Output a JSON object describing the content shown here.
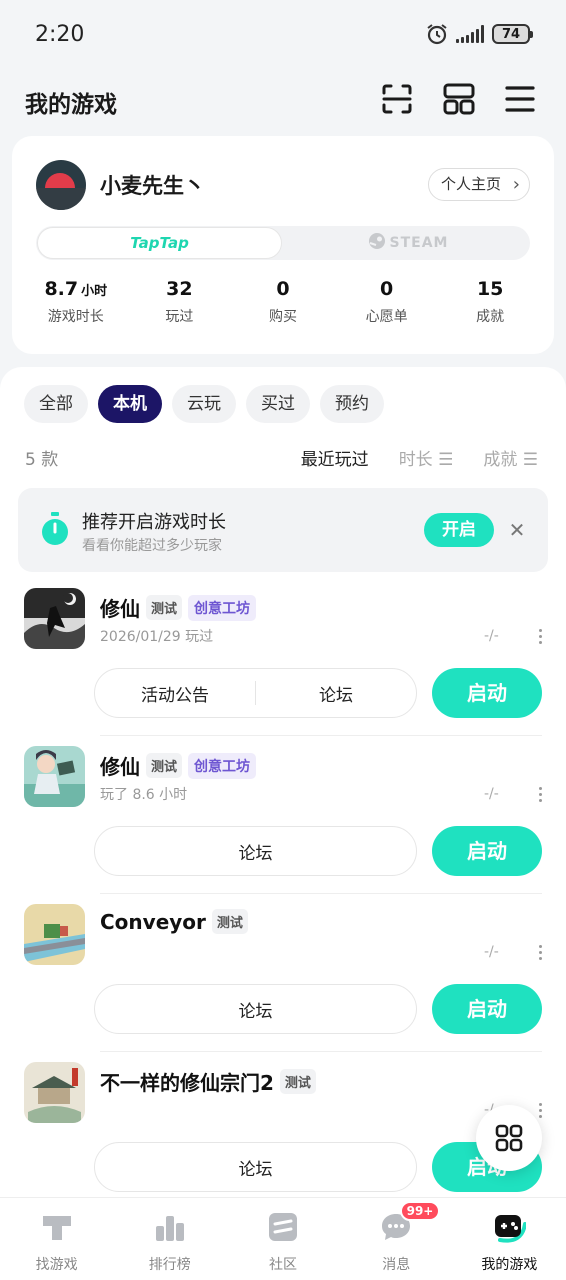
{
  "status": {
    "time": "2:20",
    "battery": "74"
  },
  "header": {
    "title": "我的游戏"
  },
  "profile": {
    "username": "小麦先生丶",
    "home_button": "个人主页",
    "platforms": {
      "taptap": "TapTap",
      "steam": "STEAM"
    },
    "stats": [
      {
        "value": "8.7",
        "unit": "小时",
        "label": "游戏时长"
      },
      {
        "value": "32",
        "unit": "",
        "label": "玩过"
      },
      {
        "value": "0",
        "unit": "",
        "label": "购买"
      },
      {
        "value": "0",
        "unit": "",
        "label": "心愿单"
      },
      {
        "value": "15",
        "unit": "",
        "label": "成就"
      }
    ]
  },
  "filters": [
    "全部",
    "本机",
    "云玩",
    "买过",
    "预约"
  ],
  "count": "5 款",
  "sorts": [
    "最近玩过",
    "时长",
    "成就"
  ],
  "promo": {
    "title": "推荐开启游戏时长",
    "subtitle": "看看你能超过多少玩家",
    "button": "开启"
  },
  "games": [
    {
      "name": "修仙",
      "tags": [
        "测试",
        "创意工坊"
      ],
      "sub": "2026/01/29 玩过",
      "dash": "-/-",
      "links": [
        "活动公告",
        "论坛"
      ],
      "start": "启动"
    },
    {
      "name": "修仙",
      "tags": [
        "测试",
        "创意工坊"
      ],
      "sub": "玩了 8.6 小时",
      "dash": "-/-",
      "links": [
        "论坛"
      ],
      "start": "启动"
    },
    {
      "name": "Conveyor",
      "tags": [
        "测试"
      ],
      "sub": "",
      "dash": "-/-",
      "links": [
        "论坛"
      ],
      "start": "启动"
    },
    {
      "name": "不一样的修仙宗门2",
      "tags": [
        "测试"
      ],
      "sub": "",
      "dash": "-/-",
      "links": [
        "论坛"
      ],
      "start": "启动"
    }
  ],
  "tabbar": [
    {
      "label": "找游戏",
      "icon": "taptap-logo-icon"
    },
    {
      "label": "排行榜",
      "icon": "ranking-icon"
    },
    {
      "label": "社区",
      "icon": "community-icon"
    },
    {
      "label": "消息",
      "icon": "message-icon",
      "badge": "99+"
    },
    {
      "label": "我的游戏",
      "icon": "gamepad-icon"
    }
  ],
  "colors": {
    "accent": "#1fe1c0",
    "active_chip": "#1c1566",
    "badge": "#ff4b5c"
  }
}
